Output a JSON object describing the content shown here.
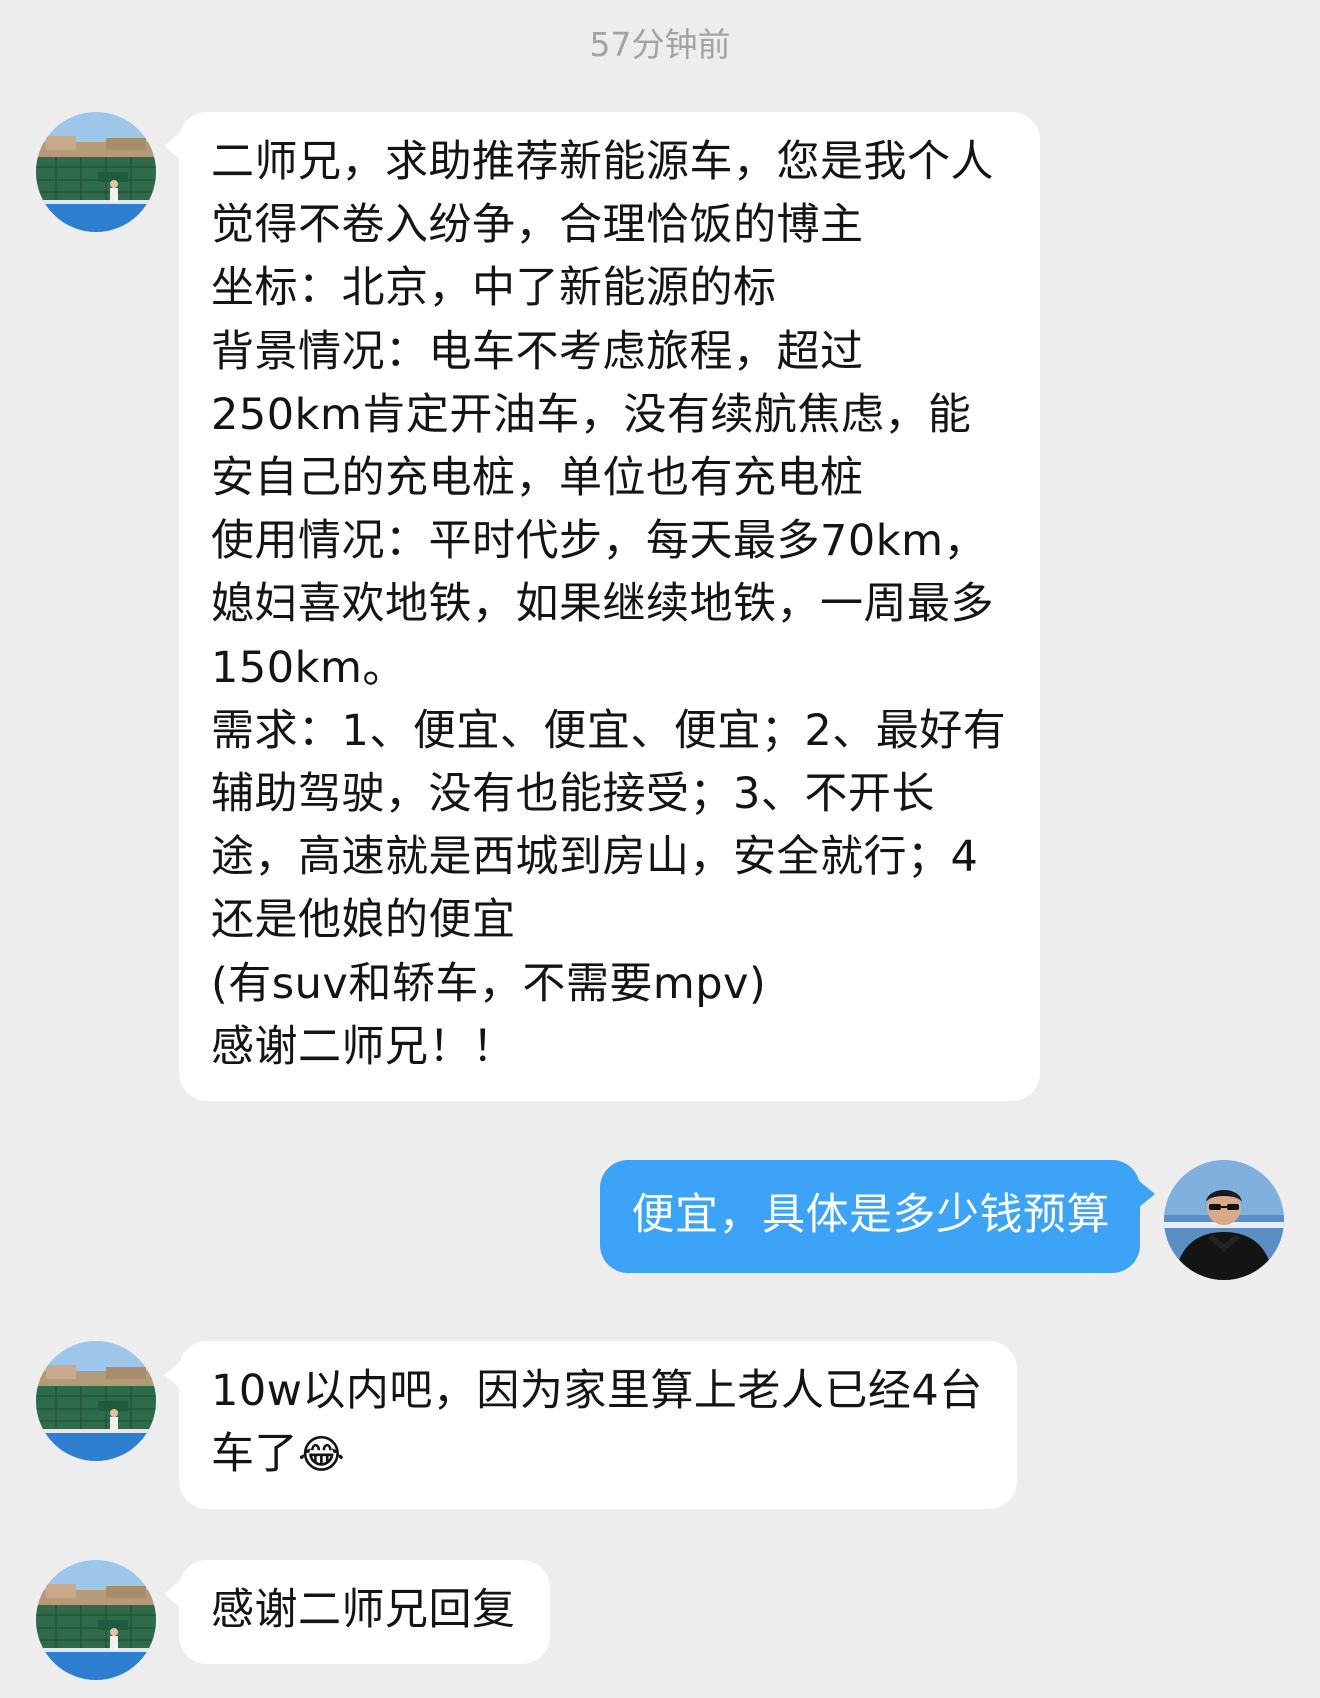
{
  "chat": {
    "timestamp": "57分钟前",
    "messages": [
      {
        "lines": [
          "二师兄，求助推荐新能源车，您是我个人",
          "觉得不卷入纷争，合理恰饭的博主",
          "坐标：北京，中了新能源的标",
          "背景情况：电车不考虑旅程，超过",
          "250km肯定开油车，没有续航焦虑，能",
          "安自己的充电桩，单位也有充电桩",
          "使用情况：平时代步，每天最多70km，",
          "媳妇喜欢地铁，如果继续地铁，一周最多",
          "150km。",
          "需求：1、便宜、便宜、便宜；2、最好有",
          "辅助驾驶，没有也能接受；3、不开长",
          "途，高速就是西城到房山，安全就行；4",
          "还是他娘的便宜",
          "(有suv和轿车，不需要mpv)",
          "感谢二师兄！！"
        ]
      },
      {
        "lines": [
          "便宜，具体是多少钱预算"
        ]
      },
      {
        "lines": [
          "10w以内吧，因为家里算上老人已经4台",
          "车了"
        ],
        "emoji": "😂"
      },
      {
        "lines": [
          "感谢二师兄回复"
        ]
      }
    ]
  },
  "colors": {
    "background": "#ededed",
    "incoming_bubble": "#ffffff",
    "outgoing_bubble": "#3ca3f6"
  },
  "icons": {
    "incoming_avatar": "tennis-court-photo-avatar",
    "outgoing_avatar": "man-in-black-hoodie-avatar"
  }
}
